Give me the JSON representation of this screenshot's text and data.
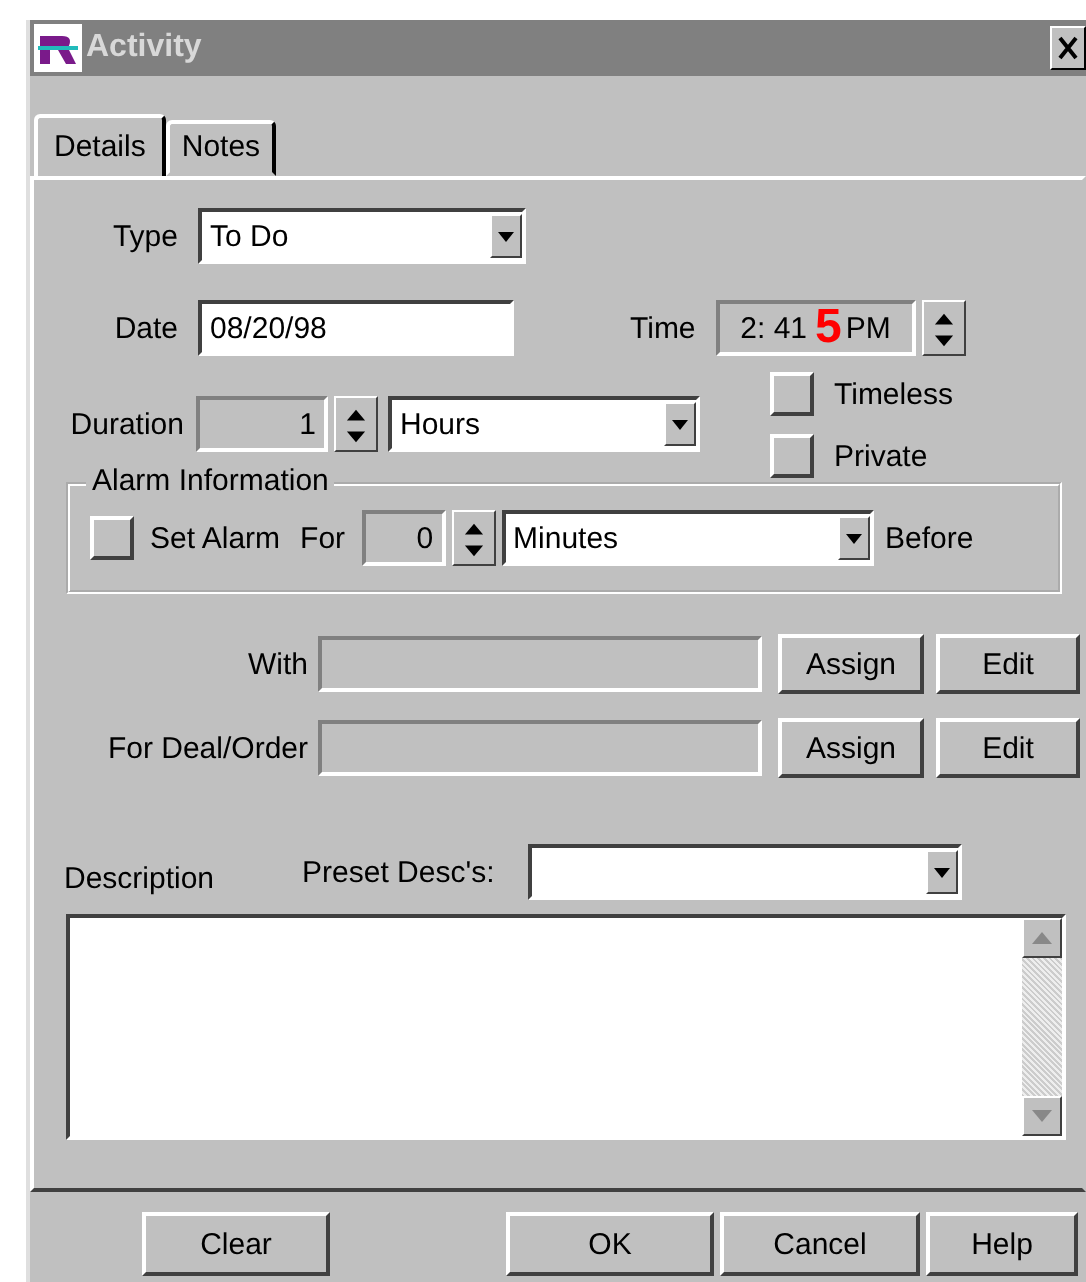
{
  "window": {
    "title": "Activity"
  },
  "tabs": [
    {
      "label": "Details",
      "selected": true
    },
    {
      "label": "Notes",
      "selected": false
    }
  ],
  "type": {
    "label": "Type",
    "value": "To Do"
  },
  "date": {
    "label": "Date",
    "value": "08/20/98"
  },
  "time": {
    "label": "Time",
    "value": "2: 41",
    "suffix": "PM"
  },
  "annotation": {
    "text": "5"
  },
  "duration": {
    "label": "Duration",
    "value": "1",
    "unit": "Hours"
  },
  "options": [
    {
      "label": "Timeless",
      "checked": false
    },
    {
      "label": "Private",
      "checked": false
    }
  ],
  "alarm": {
    "title": "Alarm Information",
    "checkbox_label": "Set Alarm",
    "checked": false,
    "for_label": "For",
    "value": "0",
    "unit": "Minutes",
    "after_label": "Before"
  },
  "links": [
    {
      "label": "With",
      "buttons": [
        "Assign",
        "Edit"
      ]
    },
    {
      "label": "For Deal/Order",
      "buttons": [
        "Assign",
        "Edit"
      ]
    }
  ],
  "description": {
    "label": "Description",
    "preset_label": "Preset Desc's:"
  },
  "buttons": [
    "Clear",
    "OK",
    "Cancel",
    "Help"
  ]
}
